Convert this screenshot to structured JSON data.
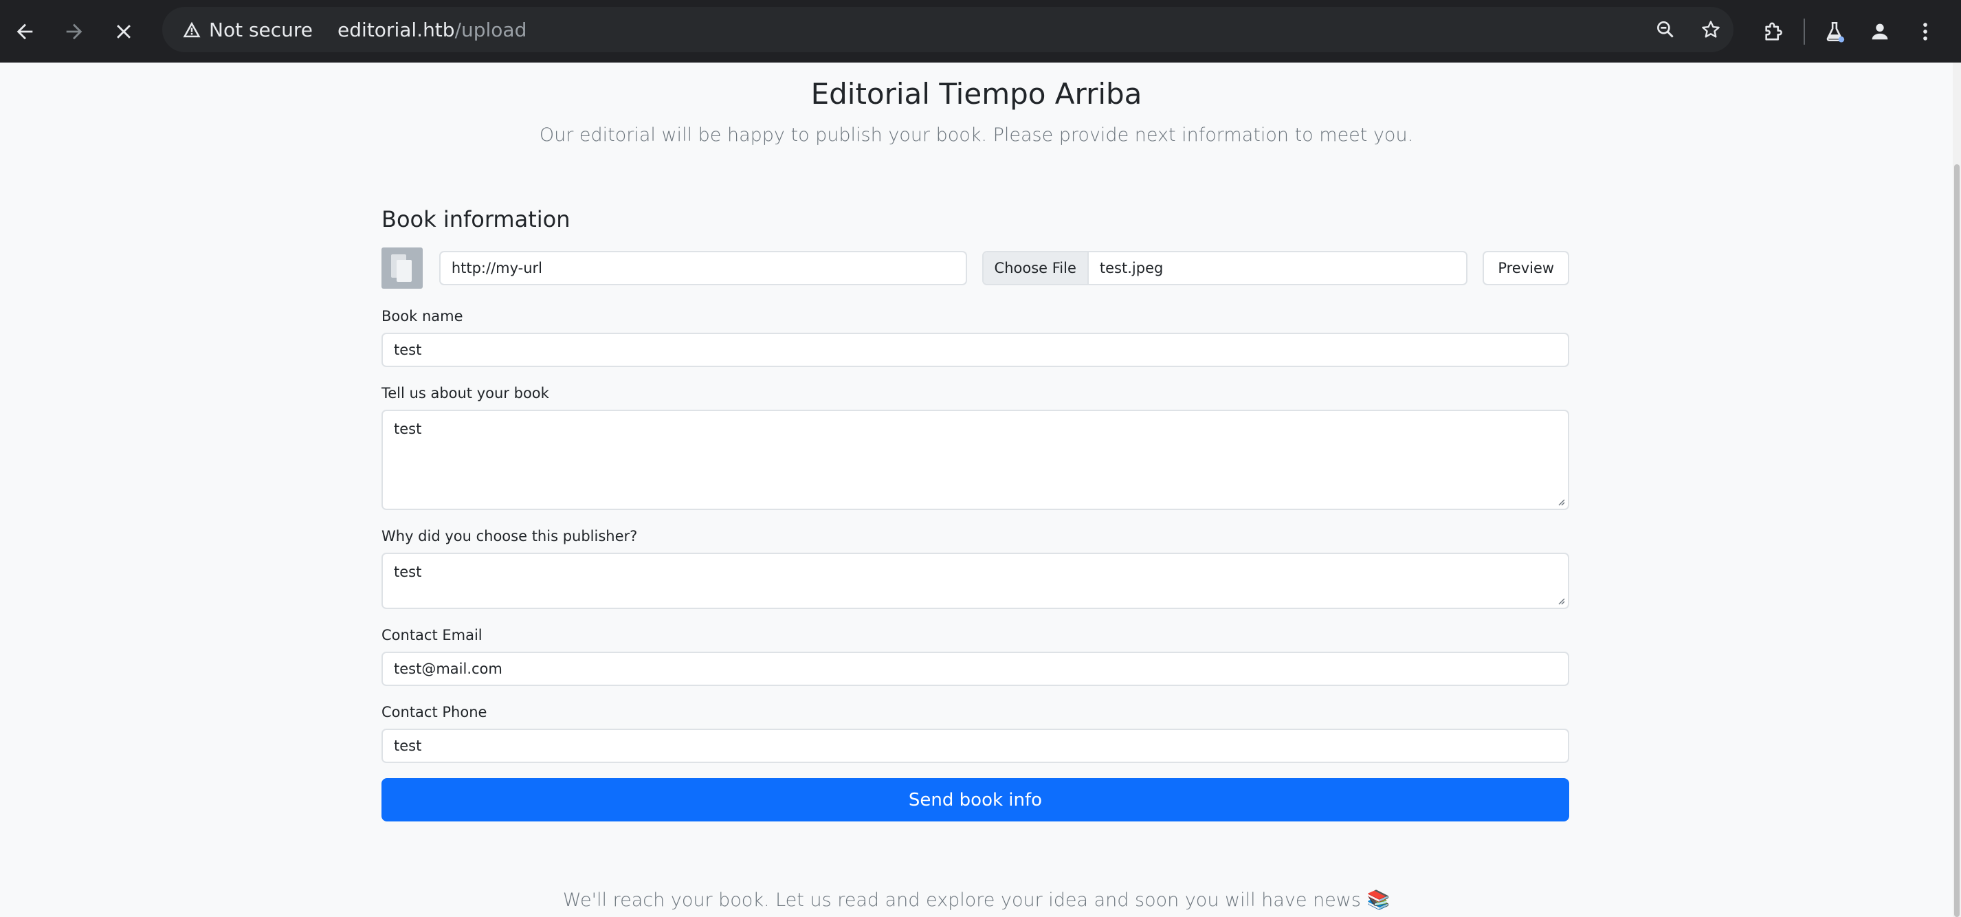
{
  "browser": {
    "security_label": "Not secure",
    "url_host": "editorial.htb",
    "url_path": "/upload"
  },
  "header": {
    "title": "Editorial Tiempo Arriba",
    "lead": "Our editorial will be happy to publish your book. Please provide next information to meet you."
  },
  "form": {
    "section_title": "Book information",
    "cover_url": "http://my-url",
    "file_button": "Choose File",
    "file_name": "test.jpeg",
    "preview_button": "Preview",
    "book_name_label": "Book name",
    "book_name_value": "test",
    "about_label": "Tell us about your book",
    "about_value": "test",
    "why_label": "Why did you choose this publisher?",
    "why_value": "test",
    "email_label": "Contact Email",
    "email_value": "test@mail.com",
    "phone_label": "Contact Phone",
    "phone_value": "test",
    "submit_label": "Send book info"
  },
  "footer": {
    "text": "We'll reach your book. Let us read and explore your idea and soon you will have news 📚"
  },
  "colors": {
    "primary": "#0d6efd",
    "chrome_bg": "#202124"
  }
}
